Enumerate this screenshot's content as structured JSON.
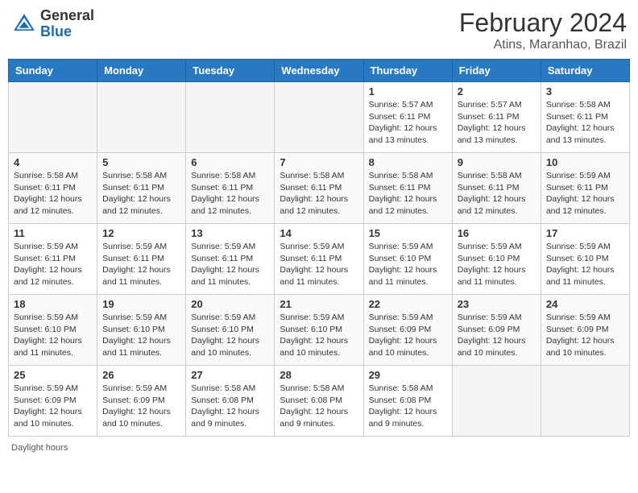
{
  "header": {
    "logo_general": "General",
    "logo_blue": "Blue",
    "month_year": "February 2024",
    "location": "Atins, Maranhao, Brazil"
  },
  "days_of_week": [
    "Sunday",
    "Monday",
    "Tuesday",
    "Wednesday",
    "Thursday",
    "Friday",
    "Saturday"
  ],
  "footer": {
    "daylight_hours": "Daylight hours"
  },
  "weeks": [
    [
      {
        "day": "",
        "info": ""
      },
      {
        "day": "",
        "info": ""
      },
      {
        "day": "",
        "info": ""
      },
      {
        "day": "",
        "info": ""
      },
      {
        "day": "1",
        "info": "Sunrise: 5:57 AM\nSunset: 6:11 PM\nDaylight: 12 hours\nand 13 minutes."
      },
      {
        "day": "2",
        "info": "Sunrise: 5:57 AM\nSunset: 6:11 PM\nDaylight: 12 hours\nand 13 minutes."
      },
      {
        "day": "3",
        "info": "Sunrise: 5:58 AM\nSunset: 6:11 PM\nDaylight: 12 hours\nand 13 minutes."
      }
    ],
    [
      {
        "day": "4",
        "info": "Sunrise: 5:58 AM\nSunset: 6:11 PM\nDaylight: 12 hours\nand 12 minutes."
      },
      {
        "day": "5",
        "info": "Sunrise: 5:58 AM\nSunset: 6:11 PM\nDaylight: 12 hours\nand 12 minutes."
      },
      {
        "day": "6",
        "info": "Sunrise: 5:58 AM\nSunset: 6:11 PM\nDaylight: 12 hours\nand 12 minutes."
      },
      {
        "day": "7",
        "info": "Sunrise: 5:58 AM\nSunset: 6:11 PM\nDaylight: 12 hours\nand 12 minutes."
      },
      {
        "day": "8",
        "info": "Sunrise: 5:58 AM\nSunset: 6:11 PM\nDaylight: 12 hours\nand 12 minutes."
      },
      {
        "day": "9",
        "info": "Sunrise: 5:58 AM\nSunset: 6:11 PM\nDaylight: 12 hours\nand 12 minutes."
      },
      {
        "day": "10",
        "info": "Sunrise: 5:59 AM\nSunset: 6:11 PM\nDaylight: 12 hours\nand 12 minutes."
      }
    ],
    [
      {
        "day": "11",
        "info": "Sunrise: 5:59 AM\nSunset: 6:11 PM\nDaylight: 12 hours\nand 12 minutes."
      },
      {
        "day": "12",
        "info": "Sunrise: 5:59 AM\nSunset: 6:11 PM\nDaylight: 12 hours\nand 11 minutes."
      },
      {
        "day": "13",
        "info": "Sunrise: 5:59 AM\nSunset: 6:11 PM\nDaylight: 12 hours\nand 11 minutes."
      },
      {
        "day": "14",
        "info": "Sunrise: 5:59 AM\nSunset: 6:11 PM\nDaylight: 12 hours\nand 11 minutes."
      },
      {
        "day": "15",
        "info": "Sunrise: 5:59 AM\nSunset: 6:10 PM\nDaylight: 12 hours\nand 11 minutes."
      },
      {
        "day": "16",
        "info": "Sunrise: 5:59 AM\nSunset: 6:10 PM\nDaylight: 12 hours\nand 11 minutes."
      },
      {
        "day": "17",
        "info": "Sunrise: 5:59 AM\nSunset: 6:10 PM\nDaylight: 12 hours\nand 11 minutes."
      }
    ],
    [
      {
        "day": "18",
        "info": "Sunrise: 5:59 AM\nSunset: 6:10 PM\nDaylight: 12 hours\nand 11 minutes."
      },
      {
        "day": "19",
        "info": "Sunrise: 5:59 AM\nSunset: 6:10 PM\nDaylight: 12 hours\nand 11 minutes."
      },
      {
        "day": "20",
        "info": "Sunrise: 5:59 AM\nSunset: 6:10 PM\nDaylight: 12 hours\nand 10 minutes."
      },
      {
        "day": "21",
        "info": "Sunrise: 5:59 AM\nSunset: 6:10 PM\nDaylight: 12 hours\nand 10 minutes."
      },
      {
        "day": "22",
        "info": "Sunrise: 5:59 AM\nSunset: 6:09 PM\nDaylight: 12 hours\nand 10 minutes."
      },
      {
        "day": "23",
        "info": "Sunrise: 5:59 AM\nSunset: 6:09 PM\nDaylight: 12 hours\nand 10 minutes."
      },
      {
        "day": "24",
        "info": "Sunrise: 5:59 AM\nSunset: 6:09 PM\nDaylight: 12 hours\nand 10 minutes."
      }
    ],
    [
      {
        "day": "25",
        "info": "Sunrise: 5:59 AM\nSunset: 6:09 PM\nDaylight: 12 hours\nand 10 minutes."
      },
      {
        "day": "26",
        "info": "Sunrise: 5:59 AM\nSunset: 6:09 PM\nDaylight: 12 hours\nand 10 minutes."
      },
      {
        "day": "27",
        "info": "Sunrise: 5:58 AM\nSunset: 6:08 PM\nDaylight: 12 hours\nand 9 minutes."
      },
      {
        "day": "28",
        "info": "Sunrise: 5:58 AM\nSunset: 6:08 PM\nDaylight: 12 hours\nand 9 minutes."
      },
      {
        "day": "29",
        "info": "Sunrise: 5:58 AM\nSunset: 6:08 PM\nDaylight: 12 hours\nand 9 minutes."
      },
      {
        "day": "",
        "info": ""
      },
      {
        "day": "",
        "info": ""
      }
    ]
  ]
}
